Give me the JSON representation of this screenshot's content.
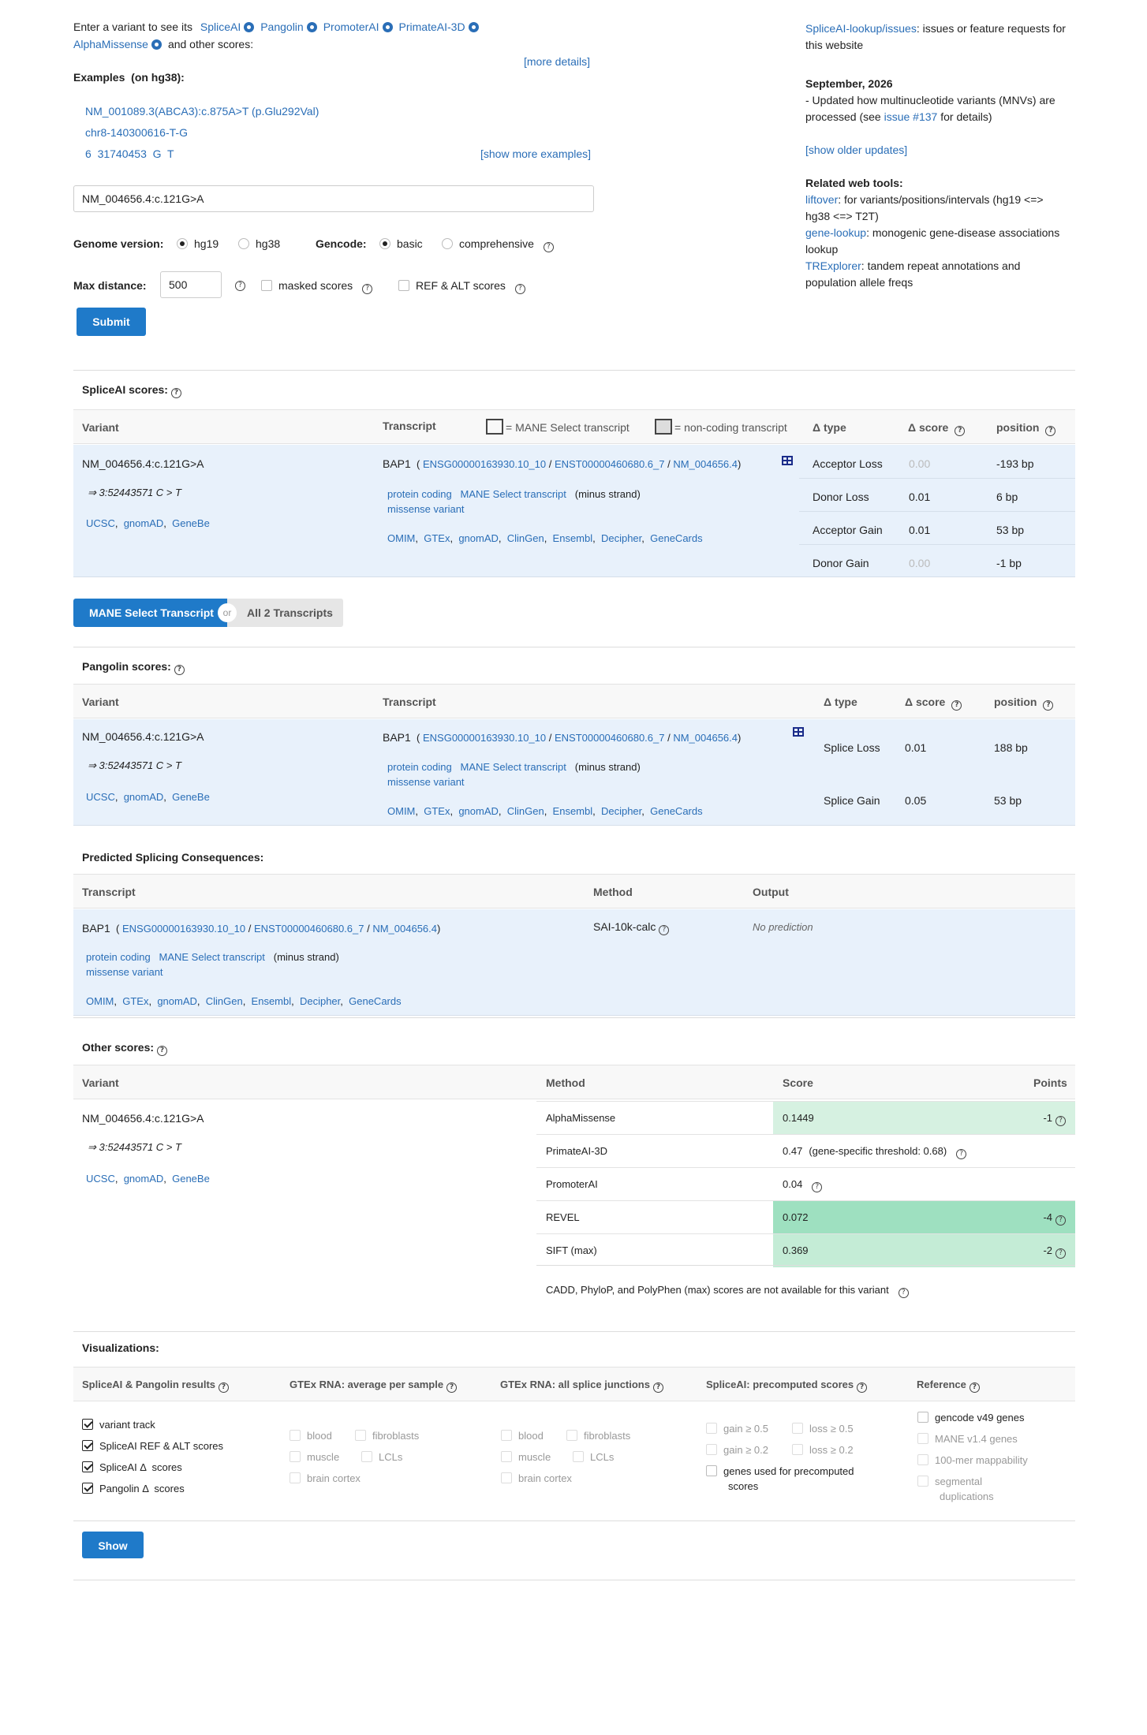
{
  "intro": {
    "lead": "Enter a variant to see its",
    "tools": [
      "SpliceAI",
      "Pangolin",
      "PromoterAI",
      "PrimateAI-3D",
      "AlphaMissense"
    ],
    "tail": "and other scores:",
    "more_details": "[more details]",
    "examples_label": "Examples",
    "examples_suffix": "(on hg38):",
    "examples": [
      "NM_001089.3(ABCA3):c.875A>T (p.Glu292Val)",
      "chr8-140300616-T-G",
      "6  31740453  G  T"
    ],
    "show_more": "[show more examples]"
  },
  "form": {
    "variant_value": "NM_004656.4:c.121G>A",
    "genome_label": "Genome version:",
    "genome_options": [
      "hg19",
      "hg38"
    ],
    "gencode_label": "Gencode:",
    "gencode_options": [
      "basic",
      "comprehensive"
    ],
    "max_distance_label": "Max distance:",
    "max_distance_value": "500",
    "masked_label": "masked scores",
    "refalt_label": "REF & ALT scores",
    "submit": "Submit"
  },
  "news": {
    "issues_link": "SpliceAI-lookup/issues",
    "issues_text": ": issues or feature requests for",
    "issues_text2": "this website",
    "date": "September, 2026",
    "update_line1": "- Updated how multinucleotide variants (MNVs) are",
    "update_line2": "processed (see",
    "update_link": "issue #137",
    "update_line3": "for details)",
    "show_older": "[show older updates]",
    "related_title": "Related web tools:",
    "liftover": "liftover",
    "liftover_text": ": for variants/positions/intervals (hg19 <=>",
    "liftover_text2": "hg38 <=> T2T)",
    "genelookup": "gene-lookup",
    "genelookup_text": ": monogenic gene-disease associations",
    "genelookup_text2": "lookup",
    "trexplorer": "TRExplorer",
    "trexplorer_text": ": tandem repeat annotations and",
    "trexplorer_text2": "population allele freqs"
  },
  "variant": {
    "name": "NM_004656.4:c.121G>A",
    "coords": "⇒ 3:52443571 C > T",
    "links": [
      "UCSC",
      "gnomAD",
      "GeneBe"
    ]
  },
  "transcript": {
    "gene": "BAP1",
    "ids": [
      "ENSG00000163930.10_10",
      "ENST00000460680.6_7",
      "NM_004656.4"
    ],
    "biotype": "protein coding",
    "mane": "MANE Select transcript",
    "strand": "(minus strand)",
    "consequence": "missense variant",
    "db_links": [
      "OMIM",
      "GTEx",
      "gnomAD",
      "ClinGen",
      "Ensembl",
      "Decipher",
      "GeneCards"
    ]
  },
  "spliceai": {
    "title": "SpliceAI scores:",
    "headers": {
      "variant": "Variant",
      "transcript": "Transcript",
      "mane_legend": "= MANE Select transcript",
      "noncoding_legend": "= non-coding transcript",
      "type": "Δ type",
      "score": "Δ score",
      "position": "position"
    },
    "rows": [
      {
        "type": "Acceptor Loss",
        "score": "0.00",
        "position": "-193 bp"
      },
      {
        "type": "Donor Loss",
        "score": "0.01",
        "position": "6 bp"
      },
      {
        "type": "Acceptor Gain",
        "score": "0.01",
        "position": "53 bp"
      },
      {
        "type": "Donor Gain",
        "score": "0.00",
        "position": "-1 bp"
      }
    ]
  },
  "toggle": {
    "mane": "MANE Select Transcript",
    "or": "or",
    "all": "All 2 Transcripts"
  },
  "pangolin": {
    "title": "Pangolin scores:",
    "headers": {
      "variant": "Variant",
      "transcript": "Transcript",
      "type": "Δ type",
      "score": "Δ score",
      "position": "position"
    },
    "rows": [
      {
        "type": "Splice Loss",
        "score": "0.01",
        "position": "188 bp"
      },
      {
        "type": "Splice Gain",
        "score": "0.05",
        "position": "53 bp"
      }
    ]
  },
  "consequences": {
    "title": "Predicted Splicing Consequences:",
    "headers": {
      "transcript": "Transcript",
      "method": "Method",
      "output": "Output"
    },
    "method": "SAI-10k-calc",
    "output": "No prediction"
  },
  "other": {
    "title": "Other scores:",
    "headers": {
      "variant": "Variant",
      "method": "Method",
      "score": "Score",
      "points": "Points"
    },
    "rows": [
      {
        "method": "AlphaMissense",
        "score": "0.1449",
        "points": "-1",
        "color": "#d6f1e1"
      },
      {
        "method": "PrimateAI-3D",
        "score": "0.47",
        "note": "(gene-specific threshold: 0.68)",
        "points": "",
        "color": ""
      },
      {
        "method": "PromoterAI",
        "score": "0.04",
        "points": "",
        "color": ""
      },
      {
        "method": "REVEL",
        "score": "0.072",
        "points": "-4",
        "color": "#9ee0c0"
      },
      {
        "method": "SIFT (max)",
        "score": "0.369",
        "points": "-2",
        "color": "#c4ecd6"
      }
    ],
    "unavailable": "CADD,  PhyloP,  and PolyPhen (max) scores are not available for this variant"
  },
  "viz": {
    "title": "Visualizations:",
    "headers": [
      "SpliceAI & Pangolin results",
      "GTEx RNA: average per sample",
      "GTEx RNA: all splice junctions",
      "SpliceAI: precomputed scores",
      "Reference"
    ],
    "results": [
      "variant track",
      "SpliceAI REF & ALT scores",
      "SpliceAI Δ  scores",
      "Pangolin Δ  scores"
    ],
    "gtex_avg": [
      "blood",
      "fibroblasts",
      "muscle",
      "LCLs",
      "brain cortex"
    ],
    "gtex_junc": [
      "blood",
      "fibroblasts",
      "muscle",
      "LCLs",
      "brain cortex"
    ],
    "precomp": [
      "gain ≥ 0.5",
      "loss ≥ 0.5",
      "gain ≥ 0.2",
      "loss ≥ 0.2",
      "genes used for precomputed",
      "scores"
    ],
    "reference": [
      "gencode v49 genes",
      "MANE v1.4 genes",
      "100-mer mappability",
      "segmental",
      "duplications"
    ],
    "show": "Show"
  }
}
